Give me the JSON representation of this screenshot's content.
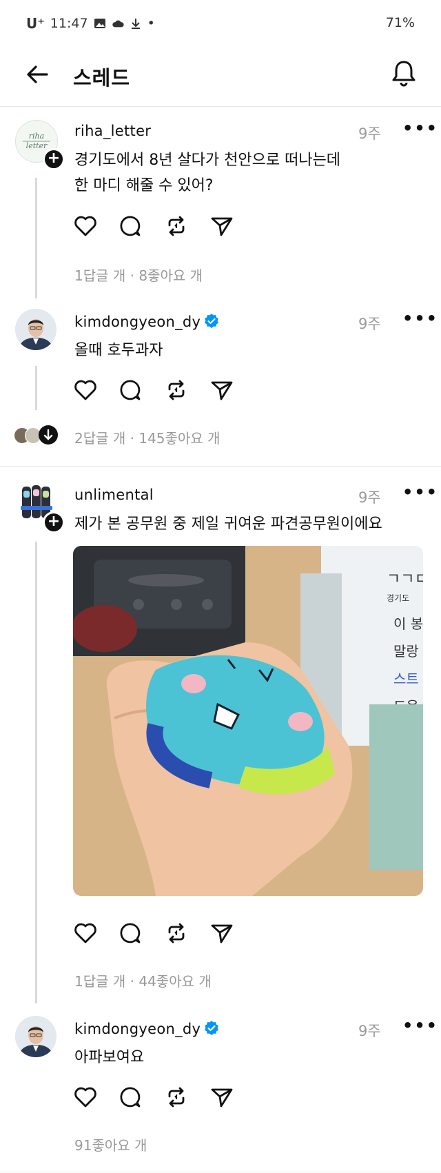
{
  "status_bar": {
    "carrier": "U⁺",
    "time": "11:47",
    "dot": "•",
    "battery": "71%"
  },
  "header": {
    "title": "스레드"
  },
  "posts": [
    {
      "username": "riha_letter",
      "time": "9주",
      "text_line1": "경기도에서 8년 살다가 천안으로 떠나는데",
      "text_line2": "한 마디 해줄 수 있어?",
      "meta": "1답글 개 · 8좋아요 개",
      "avatar_text": "riha letter"
    },
    {
      "username": "kimdongyeon_dy",
      "time": "9주",
      "text": "올때 호두과자",
      "meta": "2답글 개 · 145좋아요 개"
    },
    {
      "username": "unlimental",
      "time": "9주",
      "text": "제가 본 공무원 중 제일 귀여운 파견공무원이에요",
      "meta": "1답글 개 · 44좋아요 개",
      "photo_note": "경기도 doll toy"
    },
    {
      "username": "kimdongyeon_dy",
      "time": "9주",
      "text": "아파보여요",
      "meta": "91좋아요 개"
    }
  ],
  "colors": {
    "verified": "#0095f6",
    "muted": "#999999",
    "line": "#d9d9d9"
  },
  "icons": [
    "back-arrow-icon",
    "bell-icon",
    "heart-icon",
    "comment-icon",
    "repost-icon",
    "share-icon",
    "verified-icon",
    "more-icon",
    "plus-icon"
  ]
}
